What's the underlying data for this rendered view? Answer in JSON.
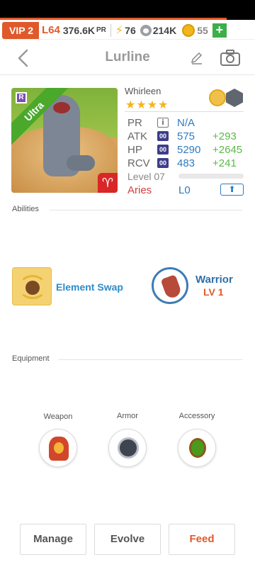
{
  "status_bar": {
    "vip": "VIP 2",
    "level": "L64",
    "power": "376.6K",
    "power_unit": "PR",
    "energy": "76",
    "food": "214K",
    "coins": "55",
    "add": "+"
  },
  "header": {
    "title": "Lurline"
  },
  "card": {
    "rarity_ribbon": "Ultra",
    "rarity_badge": "R",
    "species": "Whirleen",
    "stars": "★★★★",
    "stats": [
      {
        "label": "PR",
        "icon": "i",
        "value": "N/A",
        "bonus": ""
      },
      {
        "label": "ATK",
        "icon": "00",
        "value": "575",
        "bonus": "+293"
      },
      {
        "label": "HP",
        "icon": "00",
        "value": "5290",
        "bonus": "+2645"
      },
      {
        "label": "RCV",
        "icon": "00",
        "value": "483",
        "bonus": "+241"
      }
    ],
    "level": "Level 07",
    "level_progress": 0,
    "zodiac": "Aries",
    "zodiac_symbol": "♈",
    "zodiac_level": "L0",
    "upgrade_icon": "⬆"
  },
  "abilities": {
    "title": "Abilities",
    "ability": {
      "name": "Element Swap"
    },
    "class": {
      "name": "Warrior",
      "level": "LV 1"
    }
  },
  "equipment": {
    "title": "Equipment",
    "slots": [
      {
        "label": "Weapon"
      },
      {
        "label": "Armor"
      },
      {
        "label": "Accessory"
      }
    ]
  },
  "actions": {
    "manage": "Manage",
    "evolve": "Evolve",
    "feed": "Feed"
  },
  "colors": {
    "accent": "#e0592a",
    "stat_blue": "#2e7bc2",
    "bonus_green": "#5cb84a",
    "star": "#f2b51c"
  }
}
